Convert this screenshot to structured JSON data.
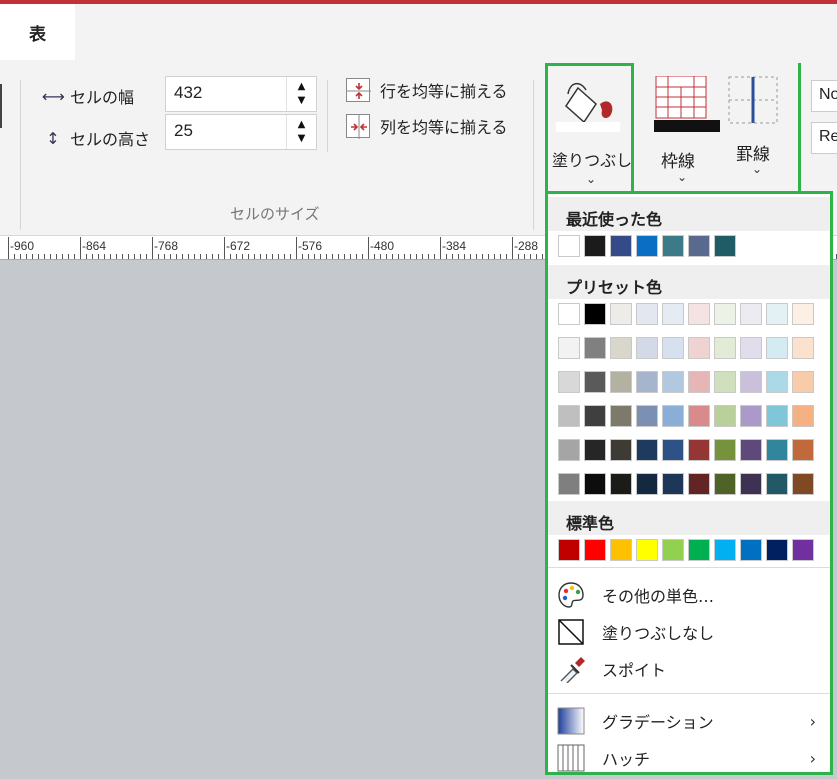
{
  "tab": {
    "label": "表"
  },
  "ribbon": {
    "width_label": "セルの幅",
    "width_value": "432",
    "height_label": "セルの高さ",
    "height_value": "25",
    "equalize_rows": "行を均等に揃える",
    "equalize_cols": "列を均等に揃える",
    "group_label": "セルのサイズ",
    "fill_label": "塗りつぶし",
    "frame_label": "枠線",
    "rule_label": "罫線",
    "box1": "No",
    "box2": "Re"
  },
  "ruler": {
    "labels": [
      "-960",
      "-864",
      "-768",
      "-672",
      "-576",
      "-480",
      "-384",
      "-288"
    ]
  },
  "panel": {
    "recent_title": "最近使った色",
    "recent": [
      "#ffffff",
      "#1b1b1b",
      "#344b88",
      "#0a6ec4",
      "#3d7a87",
      "#5a6a8f",
      "#205c66"
    ],
    "preset_title": "プリセット色",
    "preset": [
      [
        "#ffffff",
        "#000000",
        "#eeece9",
        "#e3e7ef",
        "#e5ebf3",
        "#f5e3e3",
        "#edf2e6",
        "#edebf2",
        "#e3f1f5",
        "#fcefe4"
      ],
      [
        "#f2f2f2",
        "#808080",
        "#d9d6cc",
        "#d3d9e6",
        "#d6e0ee",
        "#efd3d3",
        "#e1ebd5",
        "#e1dded",
        "#d3ebf1",
        "#fbe2cf"
      ],
      [
        "#d8d8d8",
        "#5a5a5a",
        "#b3b1a2",
        "#a7b5cc",
        "#b2c7e0",
        "#e6b5b5",
        "#d0e0bf",
        "#cbc0dc",
        "#abd9e6",
        "#f8cca8"
      ],
      [
        "#bfbfbf",
        "#3f3f3f",
        "#7d7a6c",
        "#7b90b3",
        "#8aaed6",
        "#d98b8b",
        "#b9d09a",
        "#ab99c8",
        "#80c6d9",
        "#f5b183"
      ],
      [
        "#a5a5a5",
        "#262626",
        "#3d3b33",
        "#1f3a5f",
        "#2e5286",
        "#943634",
        "#76923c",
        "#5f497a",
        "#31859c",
        "#c0693a"
      ],
      [
        "#7f7f7f",
        "#0d0d0d",
        "#1b1b18",
        "#142840",
        "#1e3758",
        "#632523",
        "#4f6228",
        "#3f3151",
        "#215967",
        "#7f4925"
      ]
    ],
    "standard_title": "標準色",
    "standard": [
      "#c00000",
      "#ff0000",
      "#ffc000",
      "#ffff00",
      "#92d050",
      "#00b050",
      "#00b0f0",
      "#0070c0",
      "#002060",
      "#7030a0"
    ],
    "menu": {
      "more_colors": "その他の単色…",
      "no_fill": "塗りつぶしなし",
      "eyedropper": "スポイト",
      "gradient": "グラデーション",
      "hatch": "ハッチ"
    }
  }
}
